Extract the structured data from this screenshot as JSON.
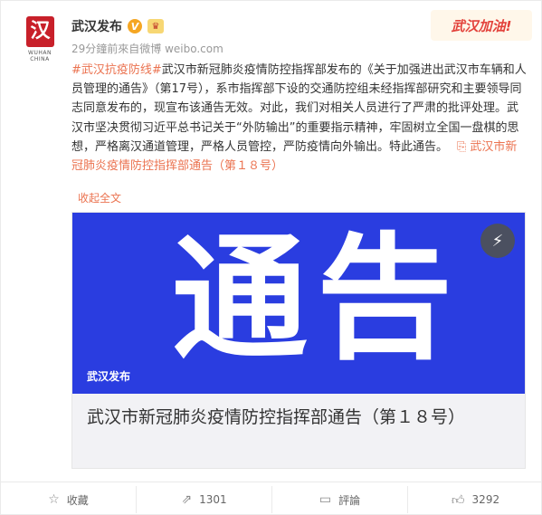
{
  "header": {
    "avatar_seal": "汉",
    "avatar_caption": "WUHAN CHINA",
    "name": "武汉发布",
    "meta": "29分鐘前來自微博 weibo.com",
    "badge_text": "武汉加油!"
  },
  "post": {
    "topic": "#武汉抗疫防线#",
    "body": "武汉市新冠肺炎疫情防控指挥部发布的《关于加强进出武汉市车辆和人员管理的通告》（第17号），系市指挥部下设的交通防控组未经指挥部研究和主要领导同志同意发布的，现宣布该通告无效。对此，我们对相关人员进行了严肃的批评处理。武汉市坚决贯彻习近平总书记关于“外防输出”的重要指示精神，牢固树立全国一盘棋的思想，严格离汉通道管理，严格人员管控，严防疫情向外输出。特此通告。",
    "link_text": "武汉市新冠肺炎疫情防控指挥部通告（第１８号）",
    "collapse_label": "收起全文"
  },
  "card": {
    "image_text": "通告",
    "image_source": "武汉发布",
    "title": "武汉市新冠肺炎疫情防控指挥部通告（第１８号）"
  },
  "footer": {
    "favorite_label": "收藏",
    "repost_count": "1301",
    "comment_label": "評論",
    "like_count": "3292"
  },
  "colors": {
    "accent": "#eb7350",
    "card_blue": "#2a3de0",
    "badge_red": "#e3433c"
  },
  "icons": {
    "verified": "verified-v-icon",
    "member": "gold-member-icon",
    "link": "link-icon",
    "flash": "flash-icon",
    "favorite": "star-icon",
    "repost": "repost-icon",
    "comment": "comment-icon",
    "like": "thumbs-up-icon"
  }
}
